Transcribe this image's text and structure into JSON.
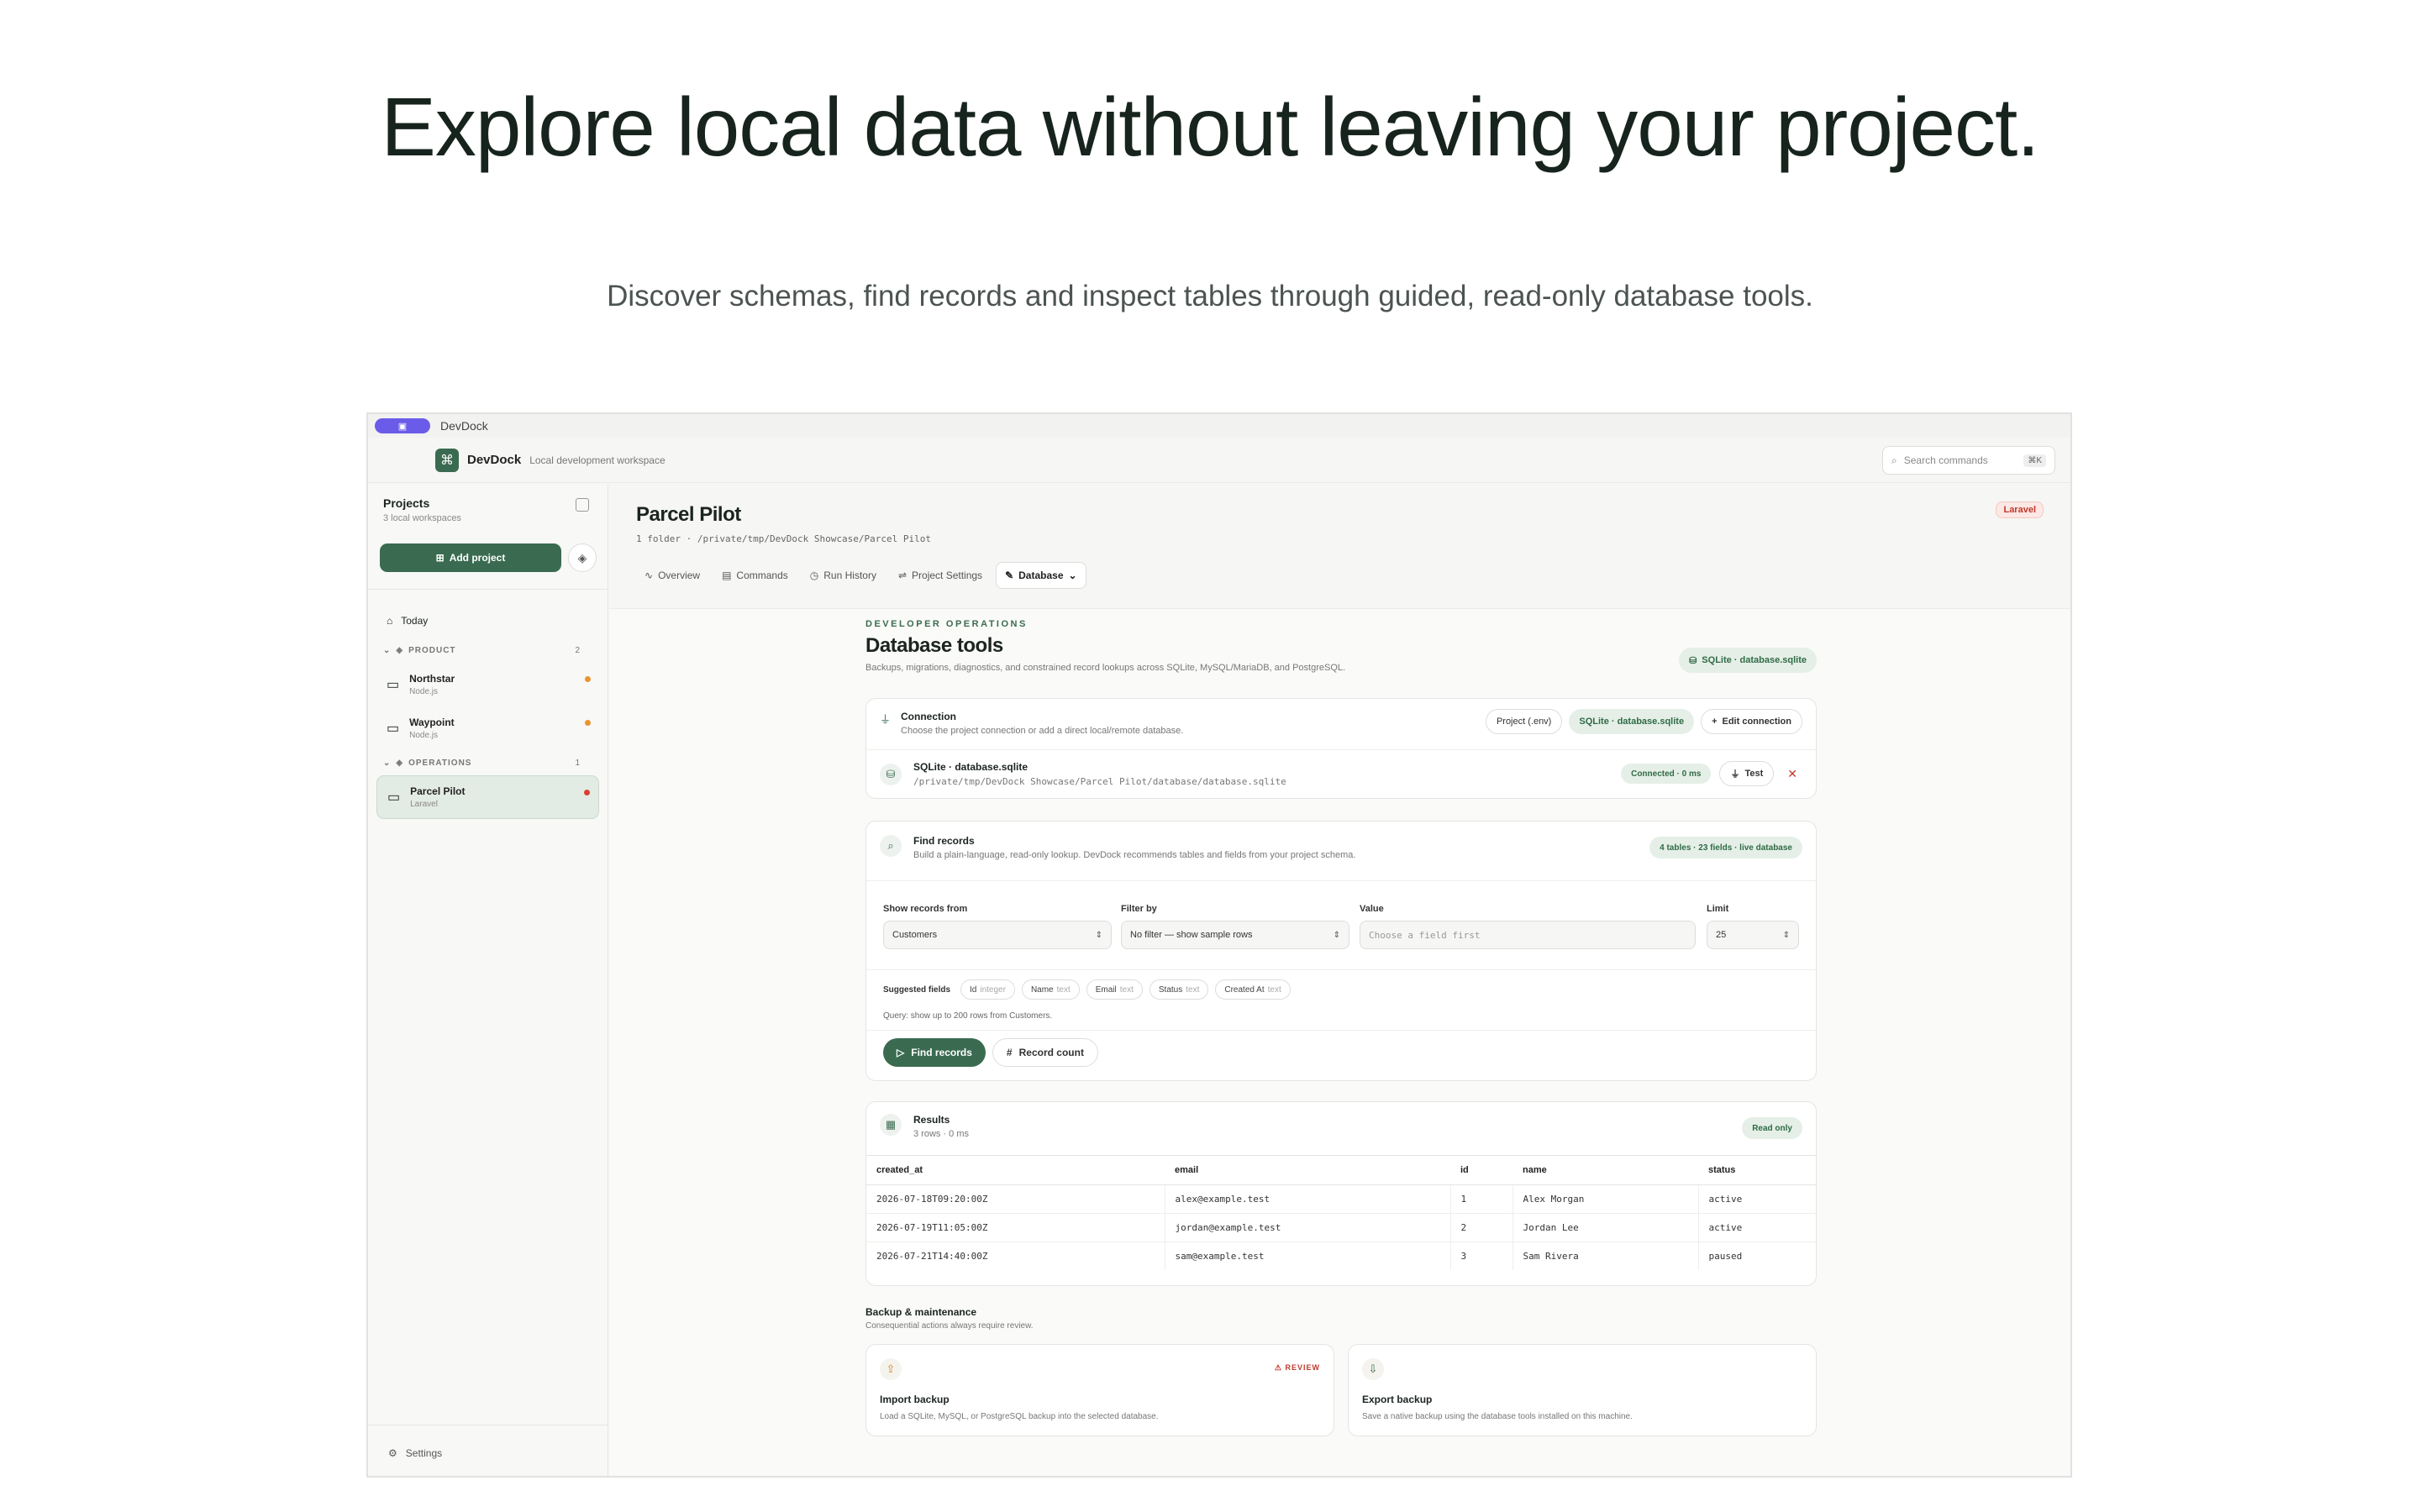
{
  "hero": {
    "title": "Explore local data without leaving your project.",
    "subtitle": "Discover schemas, find records and inspect tables through guided, read-only database tools."
  },
  "window": {
    "title": "DevDock",
    "brand": "DevDock",
    "brand_sub": "Local development workspace",
    "search_placeholder": "Search commands",
    "search_shortcut": "⌘K"
  },
  "sidebar": {
    "title": "Projects",
    "count": "3 local workspaces",
    "add_project": "Add project",
    "today": "Today",
    "groups": [
      {
        "label": "PRODUCT",
        "count": "2"
      },
      {
        "label": "OPERATIONS",
        "count": "1"
      }
    ],
    "projects": [
      {
        "name": "Northstar",
        "type": "Node.js",
        "status_color": "#e8952f"
      },
      {
        "name": "Waypoint",
        "type": "Node.js",
        "status_color": "#e8952f"
      },
      {
        "name": "Parcel Pilot",
        "type": "Laravel",
        "status_color": "#d9412f"
      }
    ],
    "settings": "Settings"
  },
  "project": {
    "title": "Parcel Pilot",
    "path": "1 folder · /private/tmp/DevDock Showcase/Parcel Pilot",
    "framework_badge": "Laravel",
    "tabs": [
      {
        "label": "Overview",
        "icon": "pulse-icon"
      },
      {
        "label": "Commands",
        "icon": "terminal-icon"
      },
      {
        "label": "Run History",
        "icon": "clock-icon"
      },
      {
        "label": "Project Settings",
        "icon": "sliders-icon"
      },
      {
        "label": "Database",
        "icon": "wrench-icon"
      }
    ]
  },
  "database": {
    "eyebrow": "DEVELOPER OPERATIONS",
    "title": "Database tools",
    "subtitle": "Backups, migrations, diagnostics, and constrained record lookups across SQLite, MySQL/MariaDB, and PostgreSQL.",
    "active_db_badge": "SQLite · database.sqlite",
    "connection": {
      "title": "Connection",
      "subtitle": "Choose the project connection or add a direct local/remote database.",
      "options": [
        "Project (.env)",
        "SQLite · database.sqlite"
      ],
      "edit": "Edit connection",
      "db_name": "SQLite · database.sqlite",
      "db_path": "/private/tmp/DevDock Showcase/Parcel Pilot/database/database.sqlite",
      "status": "Connected · 0 ms",
      "test": "Test"
    },
    "find": {
      "title": "Find records",
      "subtitle": "Build a plain-language, read-only lookup. DevDock recommends tables and fields from your project schema.",
      "badge": "4 tables · 23 fields · live database",
      "show_label": "Show records from",
      "show_value": "Customers",
      "filter_label": "Filter by",
      "filter_value": "No filter — show sample rows",
      "value_label": "Value",
      "value_placeholder": "Choose a field first",
      "limit_label": "Limit",
      "limit_value": "25",
      "suggested_label": "Suggested fields",
      "suggested": [
        {
          "name": "Id",
          "type": "integer"
        },
        {
          "name": "Name",
          "type": "text"
        },
        {
          "name": "Email",
          "type": "text"
        },
        {
          "name": "Status",
          "type": "text"
        },
        {
          "name": "Created At",
          "type": "text"
        }
      ],
      "query": "Query: show up to 200 rows from Customers.",
      "find_button": "Find records",
      "count_button": "Record count"
    },
    "results": {
      "title": "Results",
      "subtitle": "3 rows · 0 ms",
      "badge": "Read only",
      "columns": [
        "created_at",
        "email",
        "id",
        "name",
        "status"
      ],
      "rows": [
        [
          "2026-07-18T09:20:00Z",
          "alex@example.test",
          "1",
          "Alex Morgan",
          "active"
        ],
        [
          "2026-07-19T11:05:00Z",
          "jordan@example.test",
          "2",
          "Jordan Lee",
          "active"
        ],
        [
          "2026-07-21T14:40:00Z",
          "sam@example.test",
          "3",
          "Sam Rivera",
          "paused"
        ]
      ]
    },
    "backup": {
      "title": "Backup & maintenance",
      "subtitle": "Consequential actions always require review.",
      "import_title": "Import backup",
      "import_sub": "Load a SQLite, MySQL, or PostgreSQL backup into the selected database.",
      "import_badge": "REVIEW",
      "export_title": "Export backup",
      "export_sub": "Save a native backup using the database tools installed on this machine."
    }
  }
}
